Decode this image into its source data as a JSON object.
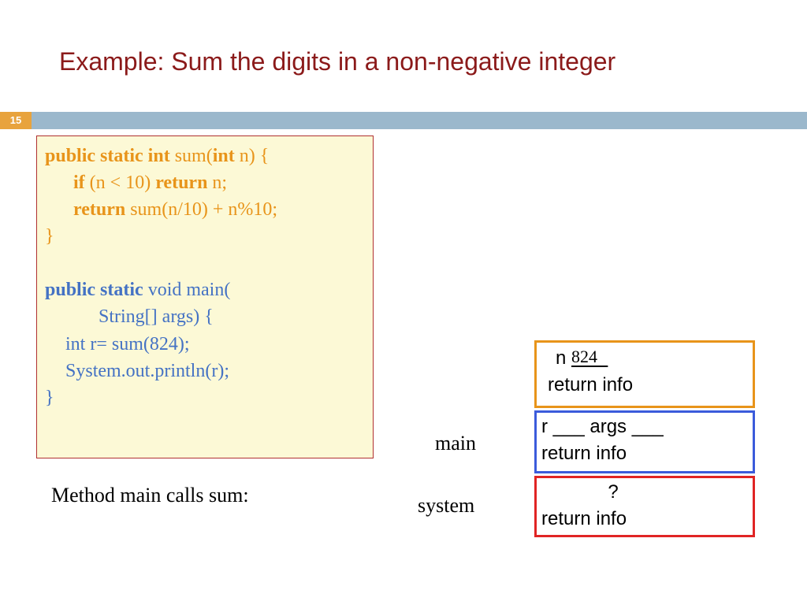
{
  "title": "Example: Sum the digits in a non-negative integer",
  "page_number": "15",
  "code": {
    "sum_sig_kw": "public static int ",
    "sum_sig_name": "sum(",
    "sum_sig_param_kw": "int ",
    "sum_sig_rest": "n) {",
    "sum_if_kw": "if ",
    "sum_if_cond": "(n < 10) ",
    "sum_if_return_kw": "return ",
    "sum_if_return_val": "n;",
    "sum_return_kw": "return ",
    "sum_return_expr": "sum(n/10)  +  n%10;",
    "sum_close": "}",
    "main_sig_kw": "public static ",
    "main_sig_rest": "void main(",
    "main_params": "String[] args) {",
    "main_line1": "int r= sum(824);",
    "main_line2": "System.out.println(r);",
    "main_close": "}"
  },
  "caption": "Method main calls sum:",
  "labels": {
    "main": "main",
    "system": "system"
  },
  "frames": {
    "orange": {
      "line1_label": "n ",
      "line1_value": "824",
      "line2": "return info"
    },
    "blue": {
      "line1": "r ___  args ___",
      "line2": "return info"
    },
    "red": {
      "line1": "?",
      "line2": "return info"
    }
  }
}
